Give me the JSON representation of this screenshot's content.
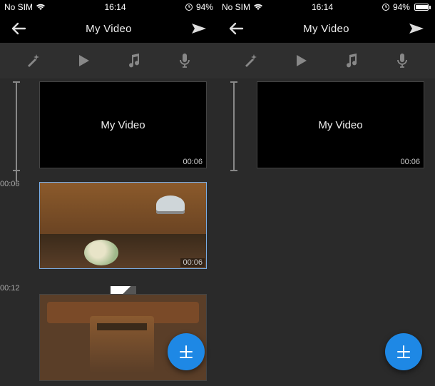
{
  "status": {
    "carrier": "No SIM",
    "time": "16:14",
    "battery_text": "94%",
    "battery_fill_pct": 94,
    "alarm_glyph": "⓪"
  },
  "nav": {
    "title": "My Video"
  },
  "toolbar": {
    "fx_label": "effects-icon",
    "play_label": "play-icon",
    "music_label": "music-icon",
    "mic_label": "mic-icon"
  },
  "timeline": {
    "labels": [
      "00:06",
      "00:12"
    ]
  },
  "clips": [
    {
      "title": "My Video",
      "duration": "00:06"
    },
    {
      "title": "",
      "duration": "00:06"
    },
    {
      "title": "",
      "duration": ""
    }
  ],
  "fab": {
    "label": "add"
  }
}
